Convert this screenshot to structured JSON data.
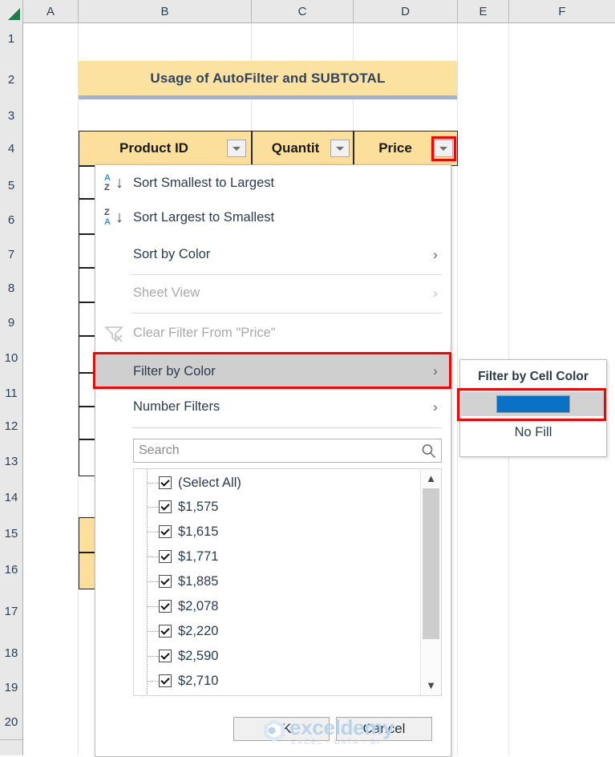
{
  "spreadsheet": {
    "columns": [
      "A",
      "B",
      "C",
      "D",
      "E",
      "F"
    ],
    "rows": [
      "1",
      "2",
      "3",
      "4",
      "5",
      "6",
      "7",
      "8",
      "9",
      "10",
      "11",
      "12",
      "13",
      "14",
      "15",
      "16",
      "17",
      "18",
      "19",
      "20"
    ],
    "select_all_corner_icon": "select-all-triangle-icon",
    "title_cell": {
      "text": "Usage of AutoFilter and SUBTOTAL",
      "fill": "#fce2a0",
      "underline_color": "#9fb2d8"
    },
    "table_headers": [
      {
        "label": "Product ID",
        "filter_icon": "filter-dropdown-icon"
      },
      {
        "label": "Quantit",
        "filter_icon": "filter-dropdown-icon"
      },
      {
        "label": "Price",
        "filter_icon": "filter-dropdown-icon"
      }
    ],
    "header_fill": "#fcdf9b"
  },
  "dropdown": {
    "menu_items": [
      {
        "label": "Sort Smallest to Largest",
        "icon": "sort-az-ascending-icon",
        "disabled": false,
        "has_submenu": false,
        "selected": false
      },
      {
        "label": "Sort Largest to Smallest",
        "icon": "sort-za-descending-icon",
        "disabled": false,
        "has_submenu": false,
        "selected": false
      },
      {
        "label": "Sort by Color",
        "icon": "",
        "disabled": false,
        "has_submenu": true,
        "selected": false
      },
      {
        "label": "Sheet View",
        "icon": "",
        "disabled": true,
        "has_submenu": true,
        "selected": false
      },
      {
        "label": "Clear Filter From \"Price\"",
        "icon": "clear-filter-funnel-icon",
        "disabled": true,
        "has_submenu": false,
        "selected": false
      },
      {
        "label": "Filter by Color",
        "icon": "",
        "disabled": false,
        "has_submenu": true,
        "selected": true
      },
      {
        "label": "Number Filters",
        "icon": "",
        "disabled": false,
        "has_submenu": true,
        "selected": false
      }
    ],
    "search": {
      "placeholder": "Search",
      "value": "",
      "icon": "search-magnifier-icon"
    },
    "list_items": [
      {
        "label": "(Select All)",
        "checked": true
      },
      {
        "label": "$1,575",
        "checked": true
      },
      {
        "label": "$1,615",
        "checked": true
      },
      {
        "label": "$1,771",
        "checked": true
      },
      {
        "label": "$1,885",
        "checked": true
      },
      {
        "label": "$2,078",
        "checked": true
      },
      {
        "label": "$2,220",
        "checked": true
      },
      {
        "label": "$2,590",
        "checked": true
      },
      {
        "label": "$2,710",
        "checked": true
      }
    ],
    "scrollbar": {
      "up_icon": "chevron-up-icon",
      "down_icon": "chevron-down-icon"
    },
    "ok_label": "OK",
    "cancel_label": "Cancel"
  },
  "submenu": {
    "title": "Filter by Cell Color",
    "swatch_color": "#0a72c4",
    "no_fill_label": "No Fill"
  },
  "highlights": {
    "accent_color": "#ff0000"
  },
  "watermark": {
    "word": "exceldemy",
    "tagline": "EXCEL - DATA - BI"
  }
}
